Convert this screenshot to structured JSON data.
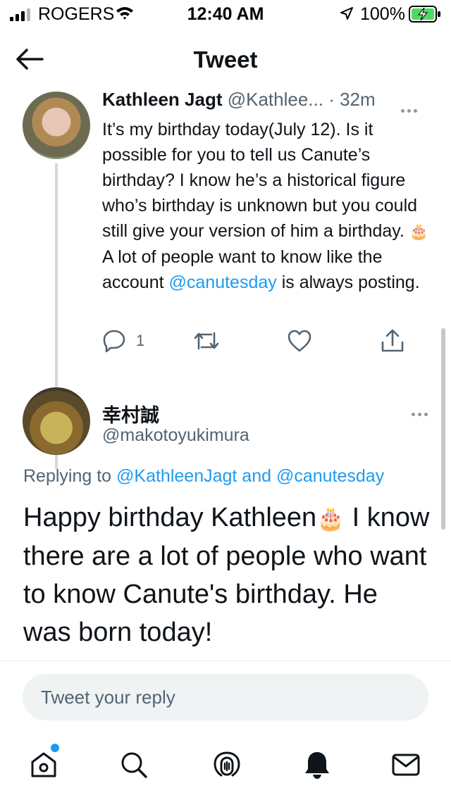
{
  "status_bar": {
    "carrier": "ROGERS",
    "time": "12:40 AM",
    "battery_percent": "100%"
  },
  "header": {
    "title": "Tweet"
  },
  "tweet1": {
    "name": "Kathleen Jagt",
    "handle": "@Kathlee...",
    "time": " · 32m",
    "body_part1": "It’s my birthday today(July 12). Is it possible for you to tell us Canute’s birthday? I know he’s a historical figure who’s birthday is unknown but you could still give your version of him a birthday. ",
    "emoji": "🎂",
    "body_part2": " A lot of people want to know like the account ",
    "mention": "@canutesday",
    "body_part3": " is always posting.",
    "reply_count": "1"
  },
  "tweet2": {
    "name": "幸村誠",
    "handle": "@makotoyukimura",
    "replying_prefix": "Replying to ",
    "replying_user1": "@KathleenJagt",
    "replying_and": " and ",
    "replying_user2": "@canutesday",
    "body_part1": "Happy birthday Kathleen",
    "emoji": "🎂",
    "body_part2": " I know there are a lot of people who want to know Canute's birthday. He was born today!"
  },
  "reply_box": {
    "placeholder": "Tweet your reply"
  },
  "tab_bar": {
    "icons": [
      "home-icon",
      "search-icon",
      "spaces-icon",
      "notifications-icon",
      "messages-icon"
    ]
  },
  "colors": {
    "accent": "#1d9bf0",
    "secondary_text": "#536471"
  }
}
